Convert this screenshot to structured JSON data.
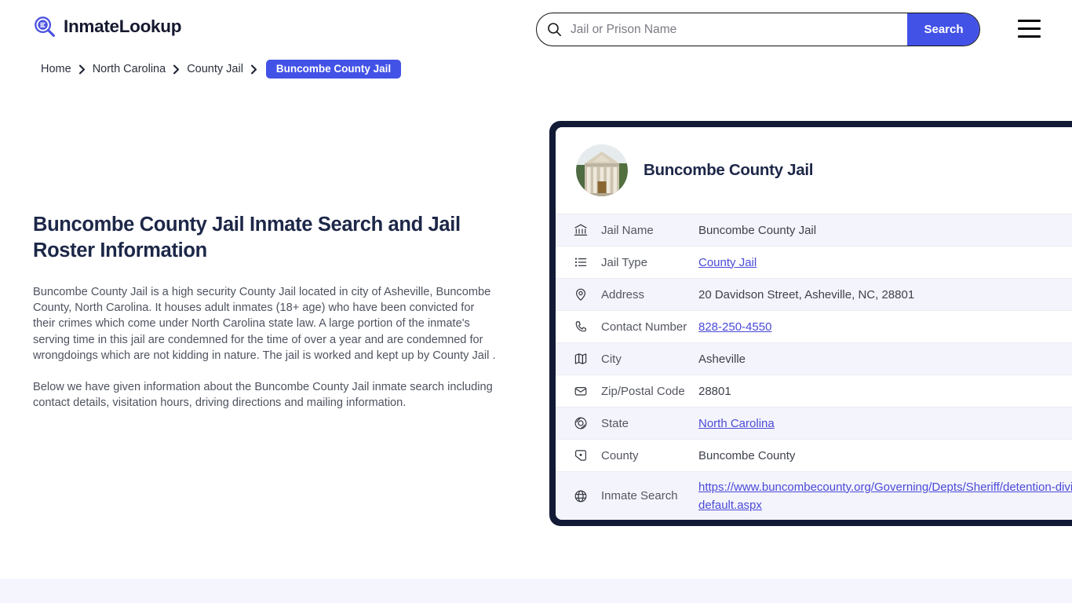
{
  "header": {
    "brand_name": "InmateLookup",
    "brand_icon": "magnifier-list-logo-icon",
    "menu_icon": "hamburger-menu-icon",
    "search": {
      "placeholder": "Jail or Prison Name",
      "value": "",
      "button_label": "Search",
      "icon": "search-icon"
    }
  },
  "breadcrumb": {
    "items": [
      {
        "label": "Home"
      },
      {
        "label": "North Carolina"
      },
      {
        "label": "County Jail"
      }
    ],
    "current": "Buncombe County Jail",
    "separator_icon": "chevron-right-icon"
  },
  "main": {
    "title": "Buncombe County Jail Inmate Search and Jail Roster Information",
    "paragraphs": [
      "Buncombe County Jail is a high security County Jail located in city of Asheville, Buncombe County, North Carolina. It houses adult inmates (18+ age) who have been convicted for their crimes which come under North Carolina state law. A large portion of the inmate's serving time in this jail are condemned for the time of over a year and are condemned for wrongdoings which are not kidding in nature. The jail is worked and kept up by County Jail .",
      "Below we have given information about the Buncombe County Jail inmate search including contact details, visitation hours, driving directions and mailing information."
    ]
  },
  "card": {
    "title": "Buncombe County Jail",
    "photo_icon": "courthouse-building-photo",
    "rows": [
      {
        "icon": "bank-building-icon",
        "label": "Jail Name",
        "value": "Buncombe County Jail",
        "is_link": false
      },
      {
        "icon": "list-icon",
        "label": "Jail Type",
        "value": "County Jail",
        "is_link": true
      },
      {
        "icon": "map-pin-icon",
        "label": "Address",
        "value": "20 Davidson Street, Asheville, NC, 28801",
        "is_link": false
      },
      {
        "icon": "phone-icon",
        "label": "Contact Number",
        "value": "828-250-4550",
        "is_link": true
      },
      {
        "icon": "folded-map-icon",
        "label": "City",
        "value": "Asheville",
        "is_link": false
      },
      {
        "icon": "envelope-icon",
        "label": "Zip/Postal Code",
        "value": "28801",
        "is_link": false
      },
      {
        "icon": "globe-icon",
        "label": "State",
        "value": "North Carolina",
        "is_link": true
      },
      {
        "icon": "county-map-icon",
        "label": "County",
        "value": "Buncombe County",
        "is_link": false
      },
      {
        "icon": "web-globe-icon",
        "label": "Inmate Search",
        "value": "https://www.buncombecounty.org/Governing/Depts/Sheriff/detention-division/default.aspx",
        "is_link": true
      }
    ]
  },
  "colors": {
    "accent_blue": "#4352e6",
    "link_blue": "#4a4ad8",
    "dark_navy": "#121a36",
    "title_navy": "#1d2748",
    "row_alt": "#f4f4fc",
    "band": "#f5f5fd"
  }
}
